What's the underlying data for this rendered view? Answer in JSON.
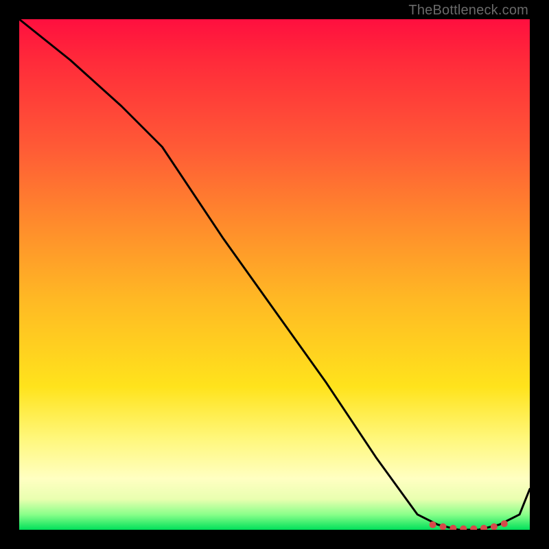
{
  "watermark": "TheBottleneck.com",
  "chart_data": {
    "type": "line",
    "title": "",
    "xlabel": "",
    "ylabel": "",
    "xlim": [
      0,
      100
    ],
    "ylim": [
      0,
      100
    ],
    "grid": false,
    "legend": false,
    "series": [
      {
        "name": "bottleneck-curve",
        "x": [
          0,
          10,
          20,
          28,
          40,
          50,
          60,
          70,
          78,
          82,
          86,
          90,
          94,
          98,
          100
        ],
        "y": [
          100,
          92,
          83,
          75,
          57,
          43,
          29,
          14,
          3,
          1,
          0,
          0,
          1,
          3,
          8
        ]
      }
    ],
    "markers": {
      "name": "bottleneck-flat-region",
      "x": [
        81,
        83,
        85,
        87,
        89,
        91,
        93,
        95
      ],
      "y": [
        1,
        0.6,
        0.3,
        0.2,
        0.2,
        0.3,
        0.6,
        1.2
      ],
      "color": "#d64a4a"
    },
    "gradient_stops": [
      {
        "pos": 0.0,
        "color": "#ff0f3f"
      },
      {
        "pos": 0.25,
        "color": "#ff5a36"
      },
      {
        "pos": 0.55,
        "color": "#ffb924"
      },
      {
        "pos": 0.82,
        "color": "#fff77a"
      },
      {
        "pos": 0.94,
        "color": "#e9ffb0"
      },
      {
        "pos": 1.0,
        "color": "#00e05a"
      }
    ]
  }
}
